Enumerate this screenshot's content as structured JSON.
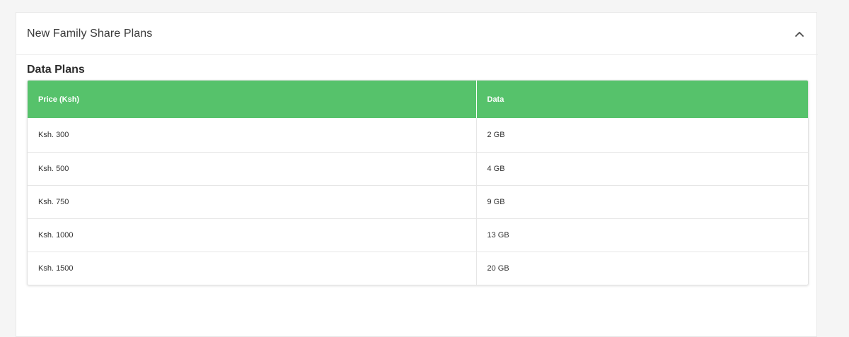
{
  "accordion": {
    "title": "New Family Share Plans",
    "toggle_icon": "chevron-up-icon",
    "expanded": true
  },
  "section": {
    "title": "Data Plans"
  },
  "table": {
    "headers": [
      "Price (Ksh)",
      "Data"
    ],
    "rows": [
      [
        "Ksh. 300",
        "2 GB"
      ],
      [
        "Ksh. 500",
        "4 GB"
      ],
      [
        "Ksh. 750",
        "9 GB"
      ],
      [
        "Ksh. 1000",
        "13 GB"
      ],
      [
        "Ksh. 1500",
        "20 GB"
      ]
    ]
  },
  "colors": {
    "header_bg": "#56c26b",
    "header_text": "#ffffff",
    "page_bg": "#f5f5f5"
  }
}
